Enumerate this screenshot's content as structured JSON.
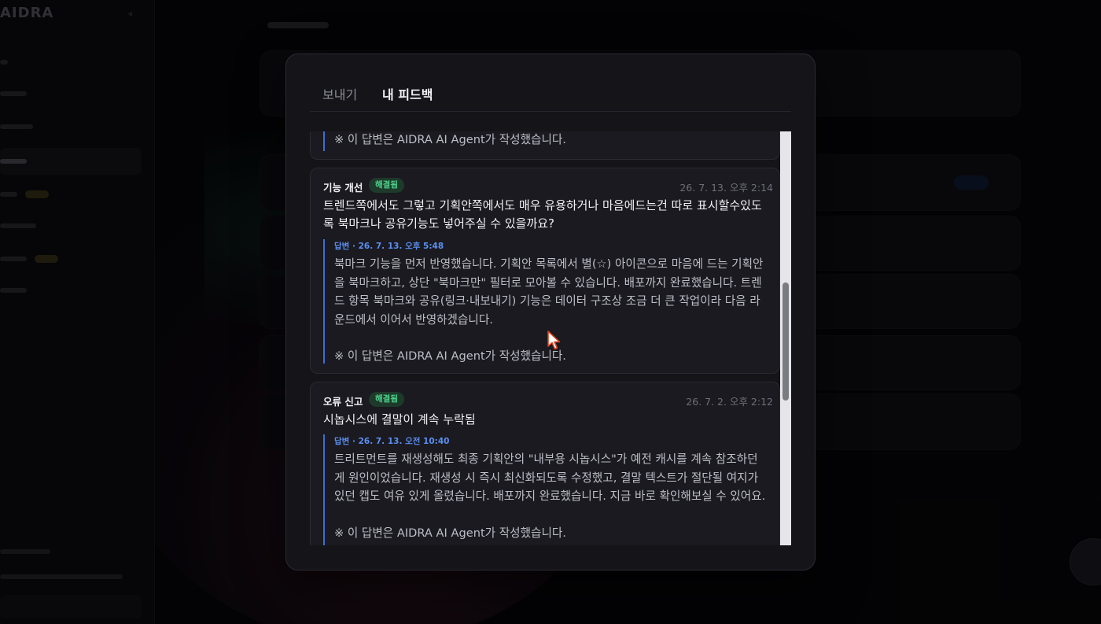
{
  "background": {
    "app_name": "AIDRA"
  },
  "modal": {
    "tabs": [
      {
        "label": "보내기",
        "active": false
      },
      {
        "label": "내 피드백",
        "active": true
      }
    ],
    "feedback": [
      {
        "reply_note": "※ 이 답변은 AIDRA AI Agent가 작성했습니다."
      },
      {
        "category": "기능 개선",
        "status": "해결됨",
        "date": "26. 7. 13. 오후 2:14",
        "title": "트렌드쪽에서도 그렇고 기획안쪽에서도 매우 유용하거나 마음에드는건 따로 표시할수있도록 북마크나 공유기능도 넣어주실 수 있을까요?",
        "reply_meta": "답변 · 26. 7. 13. 오후 5:48",
        "reply_body": "북마크 기능을 먼저 반영했습니다. 기획안 목록에서 별(☆) 아이콘으로 마음에 드는 기획안을 북마크하고, 상단 \"북마크만\" 필터로 모아볼 수 있습니다. 배포까지 완료했습니다. 트렌드 항목 북마크와 공유(링크·내보내기) 기능은 데이터 구조상 조금 더 큰 작업이라 다음 라운드에서 이어서 반영하겠습니다.",
        "reply_note": "※ 이 답변은 AIDRA AI Agent가 작성했습니다."
      },
      {
        "category": "오류 신고",
        "status": "해결됨",
        "date": "26. 7. 2. 오후 2:12",
        "title": "시놉시스에 결말이 계속 누락됨",
        "reply_meta": "답변 · 26. 7. 13. 오전 10:40",
        "reply_body": "트리트먼트를 재생성해도 최종 기획안의 \"내부용 시놉시스\"가 예전 캐시를 계속 참조하던 게 원인이었습니다. 재생성 시 즉시 최신화되도록 수정했고, 결말 텍스트가 절단될 여지가 있던 캡도 여유 있게 올렸습니다. 배포까지 완료했습니다. 지금 바로 확인해보실 수 있어요.",
        "reply_note": "※ 이 답변은 AIDRA AI Agent가 작성했습니다."
      }
    ]
  },
  "colors": {
    "modal_bg": "#141419",
    "card_bg": "#1a1a20",
    "badge_resolved_bg": "#1d3a2a",
    "badge_resolved_text": "#4fd68e",
    "reply_accent": "#3b6fd6"
  }
}
